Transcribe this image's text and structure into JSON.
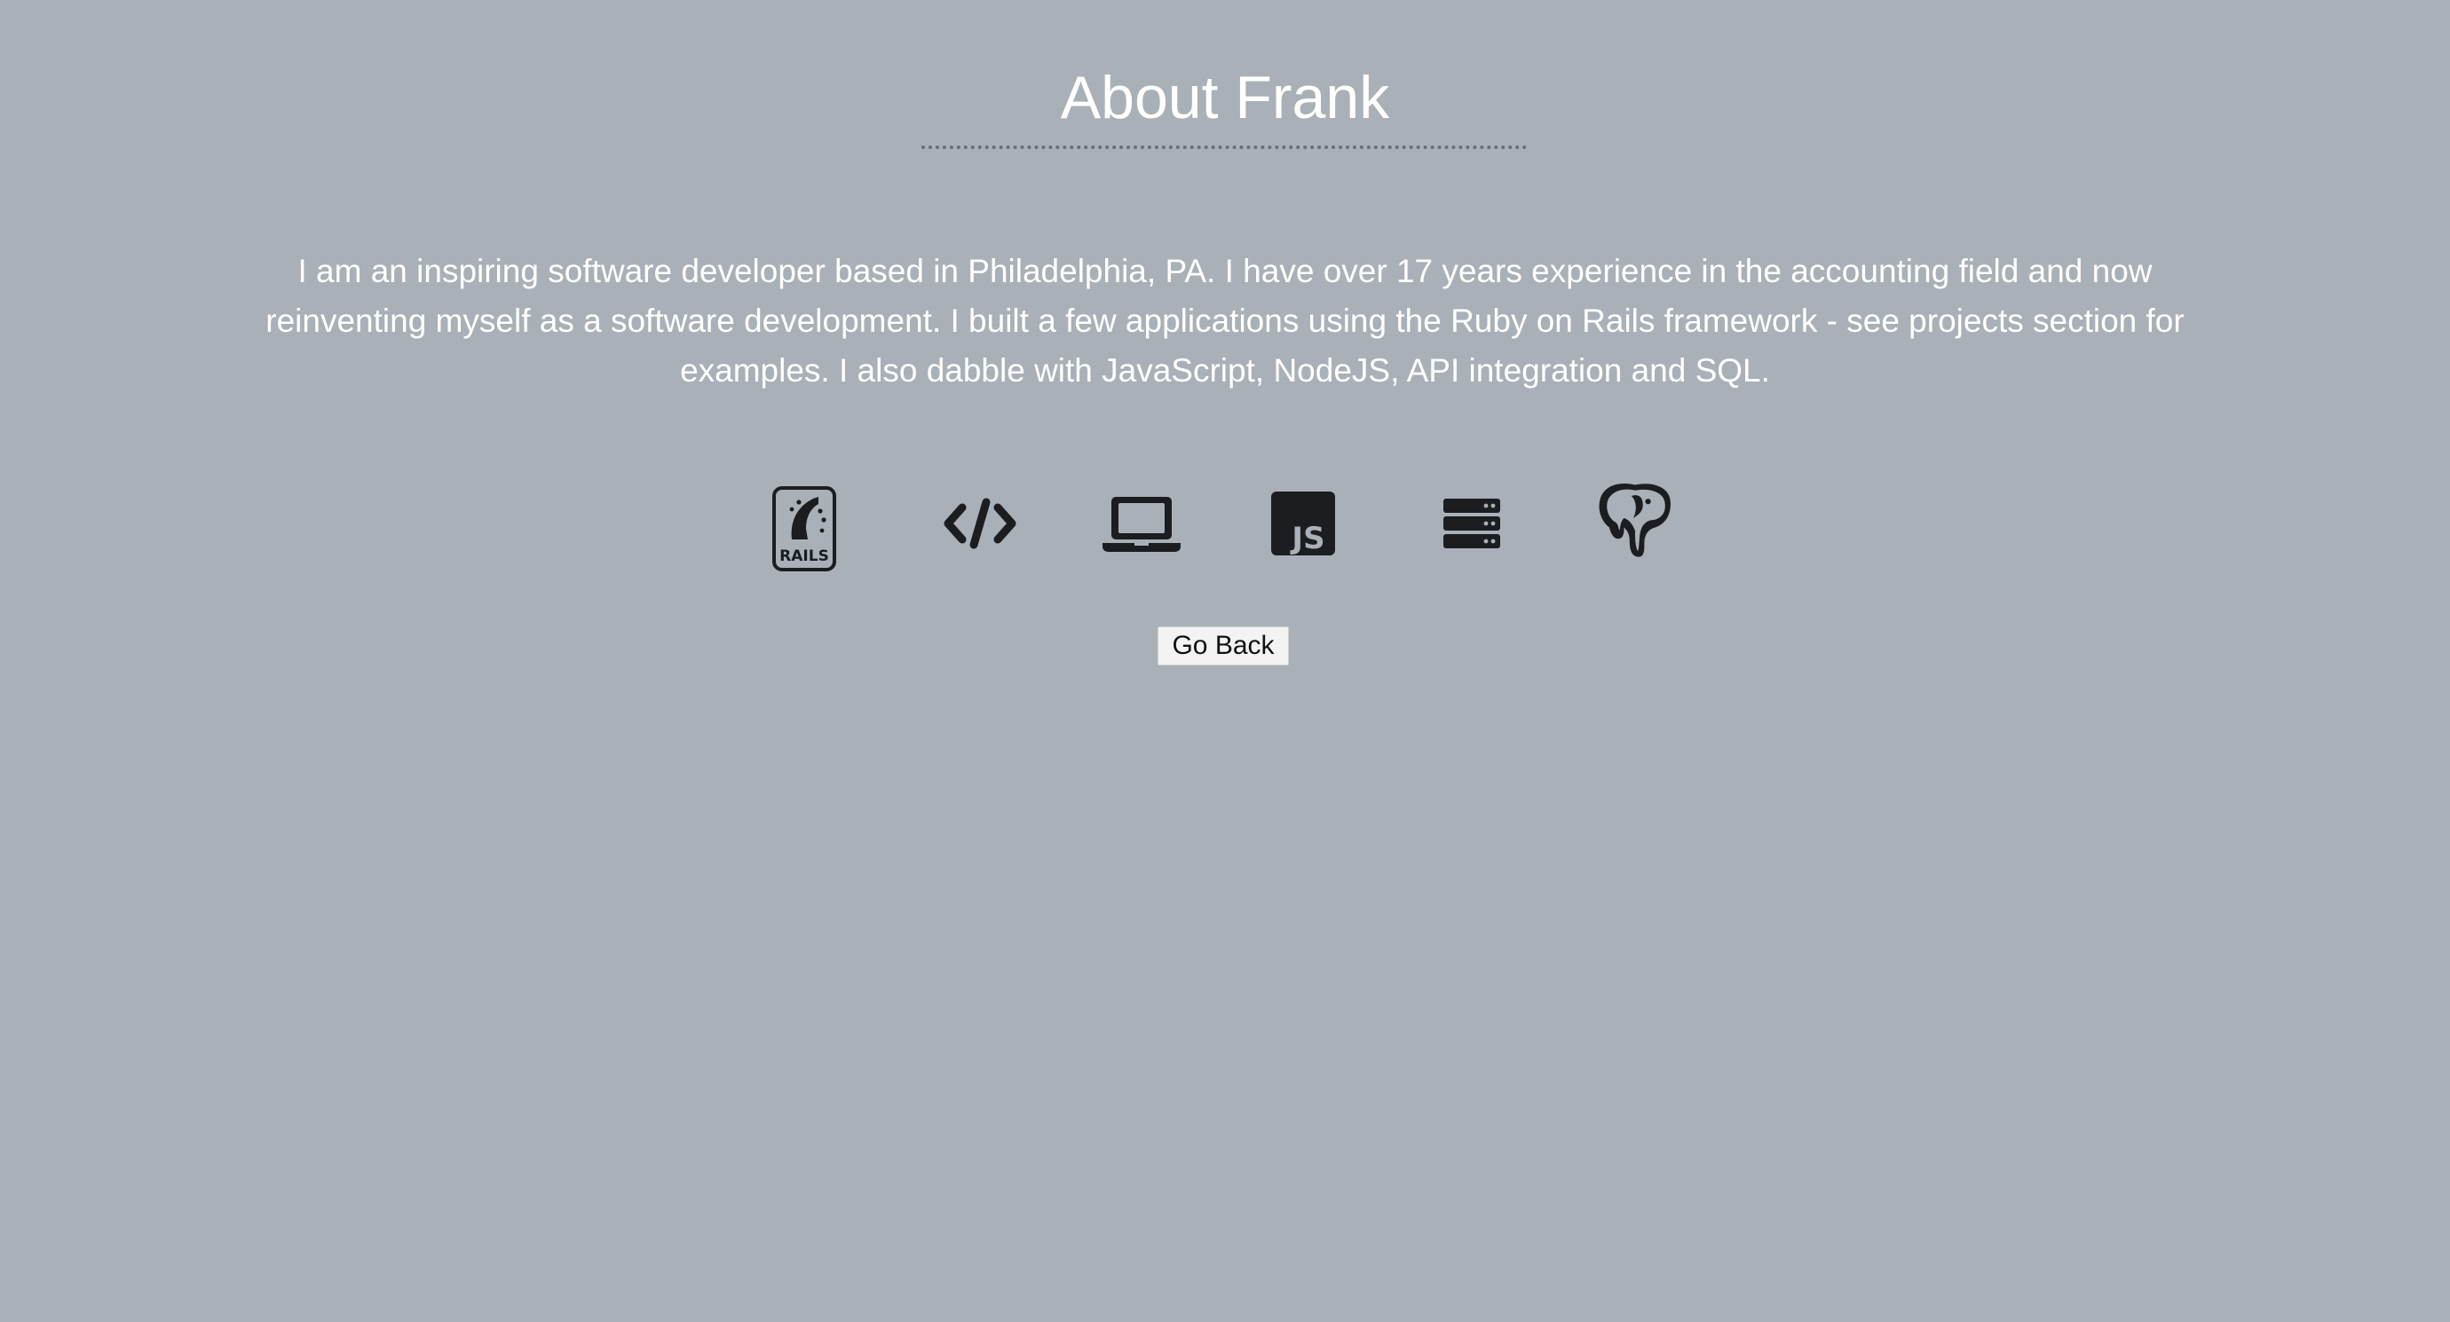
{
  "page": {
    "background_color": "#aab0b8",
    "text_color": "#ffffff",
    "icon_color": "#1b1d20"
  },
  "header": {
    "title": "About Frank"
  },
  "bio": {
    "text": "I am an inspiring software developer based in Philadelphia, PA. I have over 17 years experience in the accounting field and now reinventing myself as a software development. I built a few applications using the Ruby on Rails framework - see projects section for examples. I also dabble with JavaScript, NodeJS, API integration and SQL."
  },
  "skills": {
    "icons": [
      {
        "name": "rails-icon",
        "label": "RAILS"
      },
      {
        "name": "code-icon"
      },
      {
        "name": "laptop-icon"
      },
      {
        "name": "javascript-icon",
        "label": "JS"
      },
      {
        "name": "server-icon"
      },
      {
        "name": "postgresql-icon"
      }
    ]
  },
  "actions": {
    "go_back_label": "Go Back"
  }
}
